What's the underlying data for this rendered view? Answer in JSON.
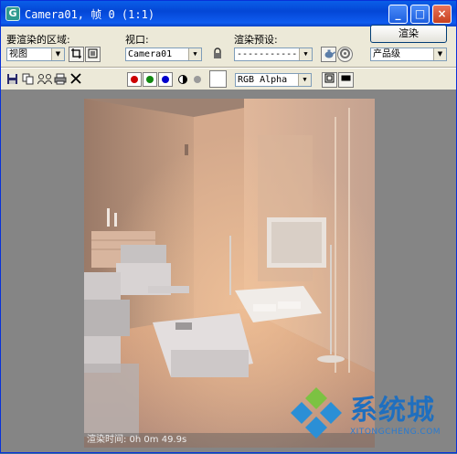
{
  "window": {
    "title": "Camera01, 帧 0 (1:1)",
    "app_icon": "G",
    "controls": {
      "minimize": "_",
      "maximize": "□",
      "close": "×"
    }
  },
  "toolbar": {
    "area_label": "要渲染的区域:",
    "area_value": "视图",
    "viewport_label": "视口:",
    "viewport_value": "Camera01",
    "preset_label": "渲染预设:",
    "preset_value": "-------------------",
    "render_button": "渲染",
    "quality_value": "产品级",
    "channel_value": "RGB Alpha"
  },
  "icons": {
    "region_edit": "crop-icon",
    "region_auto": "auto-region-icon",
    "lock": "lock-icon",
    "env_setup": "teapot-icon",
    "env_fx": "gear-icon",
    "save": "floppy-icon",
    "copy": "copy-icon",
    "clone": "clone-window-icon",
    "print": "printer-icon",
    "clear": "clear-icon",
    "mono": "half-circle-icon",
    "alpha": "grey-dot-icon",
    "swatch": "color-swatch",
    "channel_display": "channel-display-icon",
    "toggle_ui": "black-rect-icon"
  },
  "channels": [
    {
      "name": "red",
      "color": "#cc0000"
    },
    {
      "name": "green",
      "color": "#118811"
    },
    {
      "name": "blue",
      "color": "#0000cc"
    }
  ],
  "render": {
    "status": "渲染时间: 0h 0m 49.9s"
  },
  "watermark": {
    "chinese": "系统城",
    "english": "XITONGCHENG.COM"
  }
}
